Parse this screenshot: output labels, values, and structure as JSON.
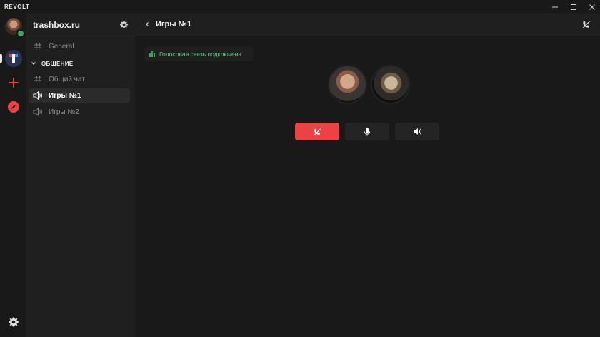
{
  "window": {
    "app_name": "REVOLT",
    "controls": [
      "minimize-icon",
      "maximize-icon",
      "close-icon"
    ]
  },
  "rail": {
    "server_initial": "T",
    "status": "online",
    "icons": [
      "plus-icon",
      "compass-icon",
      "gear-icon"
    ],
    "colors": {
      "online": "#3aa55d",
      "accent": "#ed4245"
    }
  },
  "sidebar": {
    "server_name": "trashbox.ru",
    "channels_top": [
      {
        "label": "General",
        "type": "text",
        "icon": "hash-icon"
      }
    ],
    "category": {
      "label": "ОБЩЕНИЕ",
      "icon": "chevron-down-icon"
    },
    "channels": [
      {
        "label": "Общий чат",
        "type": "text",
        "icon": "hash-icon"
      },
      {
        "label": "Игры №1",
        "type": "voice",
        "icon": "speaker-icon",
        "active": true
      },
      {
        "label": "Игры №2",
        "type": "voice",
        "icon": "speaker-icon"
      }
    ]
  },
  "main": {
    "channel_title": "Игры №1",
    "voice_status": "Голосовая связь подключена",
    "participants": [
      "avatar",
      "avatar"
    ],
    "controls": [
      "hangup-icon",
      "microphone-icon",
      "speaker-icon"
    ]
  }
}
